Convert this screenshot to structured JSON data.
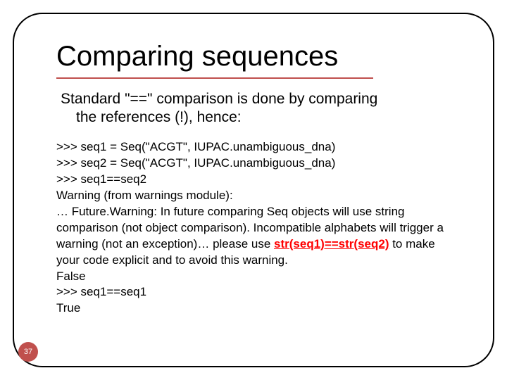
{
  "slide": {
    "title": "Comparing sequences",
    "subtitle_line1": "Standard \"==\" comparison is done by comparing",
    "subtitle_line2": "the references (!), hence:",
    "code": {
      "l1": ">>> seq1 = Seq(\"ACGT\", IUPAC.unambiguous_dna)",
      "l2": ">>> seq2 = Seq(\"ACGT\", IUPAC.unambiguous_dna)",
      "l3": ">>> seq1==seq2",
      "l4": "Warning (from warnings module):",
      "l5": "… Future.Warning: In future comparing Seq objects will use string comparison (not object comparison). Incompatible alphabets will trigger a warning (not an exception)… please use ",
      "l5_emph": "str(seq1)==str(seq2)",
      "l5_tail": " to make your code explicit and to avoid this warning.",
      "l6": "False",
      "l7": ">>> seq1==seq1",
      "l8": "True"
    },
    "page_number": "37"
  }
}
